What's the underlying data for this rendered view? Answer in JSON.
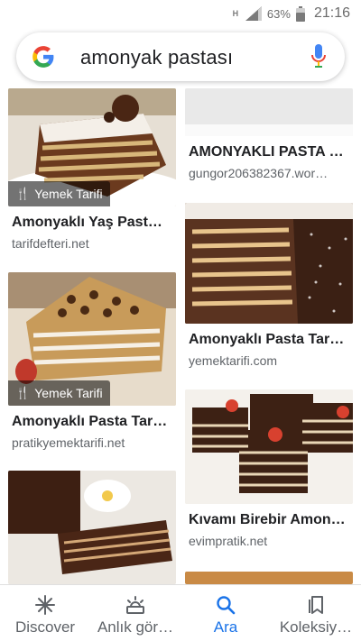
{
  "status": {
    "network": "H",
    "battery": "63%",
    "time": "21:16"
  },
  "search": {
    "query": "amonyak pastası"
  },
  "results": [
    {
      "title": "Amonyaklı Yaş Past…",
      "source": "tarifdefteri.net",
      "badge": "Yemek Tarifi"
    },
    {
      "title": "AMONYAKLI PASTA …",
      "source": "gungor206382367.wor…",
      "badge": ""
    },
    {
      "title": "Amonyaklı Pasta Tar…",
      "source": "yemektarifi.com",
      "badge": ""
    },
    {
      "title": "Amonyaklı Pasta Tar…",
      "source": "pratikyemektarifi.net",
      "badge": "Yemek Tarifi"
    },
    {
      "title": "Kıvamı Birebir Amon…",
      "source": "evimpratik.net",
      "badge": ""
    }
  ],
  "nav": [
    {
      "label": "Discover",
      "icon": "asterisk-icon",
      "active": false
    },
    {
      "label": "Anlık gör…",
      "icon": "sunrise-icon",
      "active": false
    },
    {
      "label": "Ara",
      "icon": "search-icon",
      "active": true
    },
    {
      "label": "Koleksiy…",
      "icon": "collections-icon",
      "active": false
    }
  ],
  "colors": {
    "accent": "#1a73e8",
    "text": "#202124",
    "secondary": "#5f6368"
  }
}
